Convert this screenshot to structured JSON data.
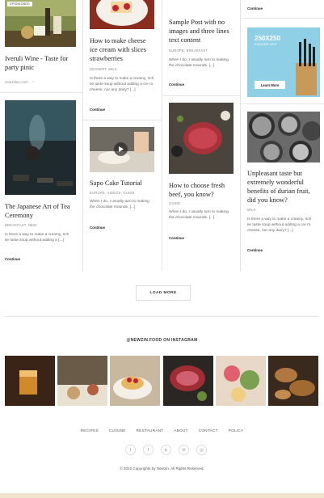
{
  "posts": {
    "col1_top": {
      "badge": "SPONSORED",
      "title_line1": "Iveruli Wine - Taste for",
      "title_line2": "party pinic",
      "meta": "newzlistn.com"
    },
    "col1_bottom": {
      "title_line1": "The Japanese Art of Tea",
      "title_line2": "Ceremony",
      "meta": "BREAKFAST, NEW",
      "excerpt_line1": "Is there a way to make a creamy, rich",
      "excerpt_line2": "tie taste soup without adding a [...]",
      "continue": "Continue"
    },
    "col2_top": {
      "title_line1": "How to make cheese",
      "title_line2": "ice cream with slices",
      "title_line3": "strawberries",
      "meta": "DESSERT, MILK",
      "excerpt_line1": "Is there a way to make a creamy, rich",
      "excerpt_line2": "tie taste soup without adding a cre ro",
      "excerpt_line3": "cheese, nor any dairy? [...]",
      "continue": "Continue"
    },
    "col2_bottom": {
      "title": "Sapo Cake Tutorial",
      "meta": "EUROPE, VIDEOS, GUIDE",
      "excerpt_line1": "When I do, I usually turn to making",
      "excerpt_line2": "the chocolate mounds. [...]",
      "continue": "Continue"
    },
    "col3_top": {
      "title_line1": "Sample Post with no",
      "title_line2": "images and three lines",
      "title_line3": "text content",
      "meta": "EUROPE, BREAKFAST",
      "excerpt_line1": "When I do, I usually turn to making",
      "excerpt_line2": "the chocolate mounds. [...]",
      "continue": "Continue"
    },
    "col3_bottom": {
      "title_line1": "How to choose fresh",
      "title_line2": "beef, you know?",
      "meta": "GUIDE",
      "excerpt_line1": "When I do, I usually turn to making",
      "excerpt_line2": "the chocolate mounds. [...]",
      "continue": "Continue"
    },
    "col4_top": {
      "continue": "Continue"
    },
    "col4_ad": {
      "size": "250X250",
      "sub": "SQUARE ADS",
      "button": "Learn More"
    },
    "col4_bottom": {
      "title_line1": "Unpleasant taste but",
      "title_line2": "extremely wonderful",
      "title_line3": "benefits of durian fruit,",
      "title_line4": "did you know?",
      "meta": "MILK",
      "excerpt_line1": "Is there a way to make a creamy, rich",
      "excerpt_line2": "tie taste soup without adding a cre ro",
      "excerpt_line3": "cheese, nor any dairy? [...]",
      "continue": "Continue"
    }
  },
  "load_more": "LOAD MORE",
  "instagram_title": "@NEWZIN.FOOD ON INSTAGRAM",
  "footer_nav": [
    "RECIPES",
    "CUISINE",
    "RESTAURANT",
    "ABOUT",
    "CONTACT",
    "POLICY"
  ],
  "social_icons": [
    "twitter-icon",
    "facebook-icon",
    "pinterest-icon",
    "email-icon",
    "instagram-icon"
  ],
  "copyright": "© 2022 Copyrights by Newzin. All Rights Reserved.",
  "colors": {
    "ad_background": "#8fd0e6",
    "footer_bar": "#f1e4cc"
  }
}
